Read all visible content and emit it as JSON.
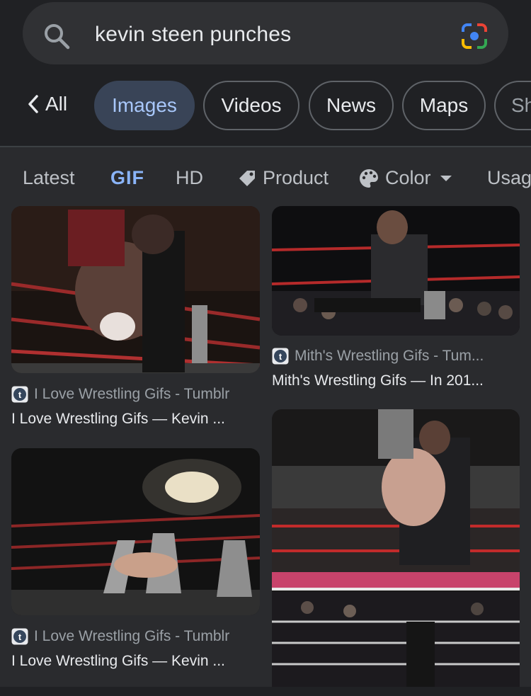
{
  "search": {
    "query": "kevin steen punches",
    "search_icon": "search-icon",
    "lens_icon": "google-lens-icon"
  },
  "tabs": [
    {
      "label": "All",
      "icon": "chevron-left-icon"
    },
    {
      "label": "Images",
      "active": true
    },
    {
      "label": "Videos"
    },
    {
      "label": "News"
    },
    {
      "label": "Maps"
    },
    {
      "label": "Sh"
    }
  ],
  "filters": [
    {
      "label": "Latest"
    },
    {
      "label": "GIF",
      "active": true
    },
    {
      "label": "HD"
    },
    {
      "label": "Product",
      "icon": "tag-icon"
    },
    {
      "label": "Color",
      "icon": "palette-icon",
      "dropdown": true
    },
    {
      "label": "Usag"
    }
  ],
  "results": [
    {
      "source": "I Love Wrestling Gifs - Tumblr",
      "title": "I Love Wrestling Gifs — Kevin ...",
      "favicon": "tumblr-icon"
    },
    {
      "source": "Mith's Wrestling Gifs - Tum...",
      "title": "Mith's Wrestling Gifs — In 201...",
      "favicon": "tumblr-icon"
    },
    {
      "source": "I Love Wrestling Gifs - Tumblr",
      "title": "I Love Wrestling Gifs — Kevin ...",
      "favicon": "tumblr-icon"
    }
  ],
  "colors": {
    "background": "#202124",
    "panel": "#2a2b2e",
    "accent": "#8ab4f8",
    "active_tab_bg": "#394457"
  }
}
